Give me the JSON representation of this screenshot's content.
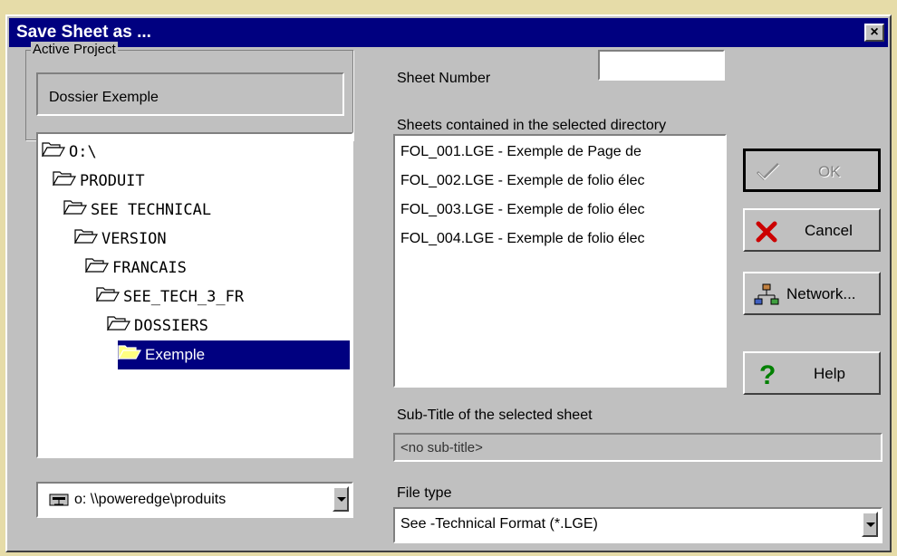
{
  "window": {
    "title": "Save Sheet as ...",
    "close_glyph": "×"
  },
  "active_project": {
    "group_label": "Active Project",
    "name": "Dossier Exemple"
  },
  "folder_tree": {
    "items": [
      {
        "label": "O:\\",
        "level": 0,
        "open": true
      },
      {
        "label": "PRODUIT",
        "level": 1,
        "open": true
      },
      {
        "label": "SEE TECHNICAL",
        "level": 2,
        "open": true
      },
      {
        "label": "VERSION",
        "level": 3,
        "open": true
      },
      {
        "label": "FRANCAIS",
        "level": 4,
        "open": true
      },
      {
        "label": "SEE_TECH_3_FR",
        "level": 5,
        "open": true
      },
      {
        "label": "DOSSIERS",
        "level": 6,
        "open": true
      },
      {
        "label": "Exemple",
        "level": 7,
        "open": true,
        "selected": true
      }
    ]
  },
  "drive": {
    "value": "o: \\\\poweredge\\produits",
    "icon": "network-drive-icon"
  },
  "sheet_number": {
    "label": "Sheet Number",
    "value": ""
  },
  "sheets": {
    "label": "Sheets contained in the selected directory",
    "items": [
      "FOL_001.LGE - Exemple de Page de",
      "FOL_002.LGE - Exemple de folio élec",
      "FOL_003.LGE - Exemple de folio élec",
      "FOL_004.LGE - Exemple de folio élec"
    ]
  },
  "subtitle": {
    "label": "Sub-Title of the selected sheet",
    "value": "<no sub-title>"
  },
  "file_type": {
    "label": "File type",
    "value": "See -Technical Format (*.LGE)"
  },
  "buttons": {
    "ok": "OK",
    "cancel": "Cancel",
    "network": "Network...",
    "help": "Help"
  },
  "colors": {
    "title_bar": "#000080",
    "selection": "#000080",
    "face": "#c0c0c0",
    "cancel_icon": "#cc0000",
    "help_icon": "#008000"
  }
}
